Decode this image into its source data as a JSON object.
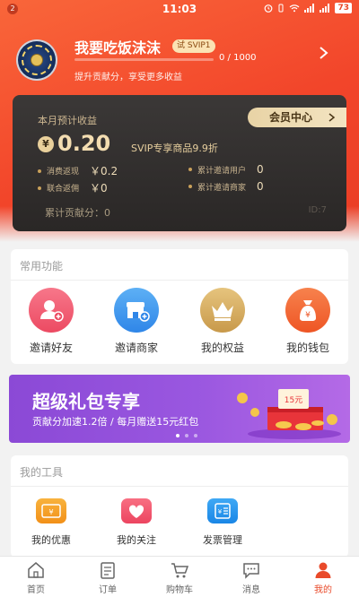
{
  "status_bar": {
    "badge": "2",
    "time": "11:03",
    "battery": "73"
  },
  "user": {
    "name": "我要吃饭沫沫",
    "badge": "试 SVIP1",
    "progress_text": "0 / 1000",
    "progress_fraction": 0.0,
    "subtitle": "提升贡献分，享受更多收益"
  },
  "earnings": {
    "title": "本月预计收益",
    "member_center": "会员中心",
    "currency": "¥",
    "amount": "0.20",
    "svip_text": "SVIP专享商品9.9折",
    "stats": [
      {
        "label": "消费返现",
        "value": "￥0.2"
      },
      {
        "label": "累计邀请用户",
        "value": "0"
      },
      {
        "label": "联合返佣",
        "value": "￥0"
      },
      {
        "label": "累计邀请商家",
        "value": "0"
      }
    ],
    "total_contribution": "累计贡献分：0",
    "id_text": "ID:7"
  },
  "common_functions": {
    "title": "常用功能",
    "items": [
      {
        "label": "邀请好友",
        "icon": "invite-friend-icon",
        "color": "#f0576a"
      },
      {
        "label": "邀请商家",
        "icon": "invite-merchant-icon",
        "color": "#3f9bf0"
      },
      {
        "label": "我的权益",
        "icon": "crown-icon",
        "color": "#d8ab5a"
      },
      {
        "label": "我的钱包",
        "icon": "money-bag-icon",
        "color": "#f1602a"
      }
    ]
  },
  "banner": {
    "title": "超级礼包专享",
    "subtitle": "贡献分加速1.2倍 / 每月赠送15元红包",
    "tag": "15元"
  },
  "my_tools": {
    "title": "我的工具",
    "items": [
      {
        "label": "我的优惠",
        "icon": "coupon-icon",
        "color": "#f5a020"
      },
      {
        "label": "我的关注",
        "icon": "heart-icon",
        "color": "#f0506a"
      },
      {
        "label": "发票管理",
        "icon": "invoice-icon",
        "color": "#2a9af0"
      }
    ]
  },
  "tabbar": {
    "items": [
      {
        "label": "首页",
        "icon": "home-icon"
      },
      {
        "label": "订单",
        "icon": "order-icon"
      },
      {
        "label": "购物车",
        "icon": "cart-icon"
      },
      {
        "label": "消息",
        "icon": "message-icon"
      },
      {
        "label": "我的",
        "icon": "profile-icon"
      }
    ],
    "active_index": 4,
    "active_color": "#e94a2a"
  }
}
